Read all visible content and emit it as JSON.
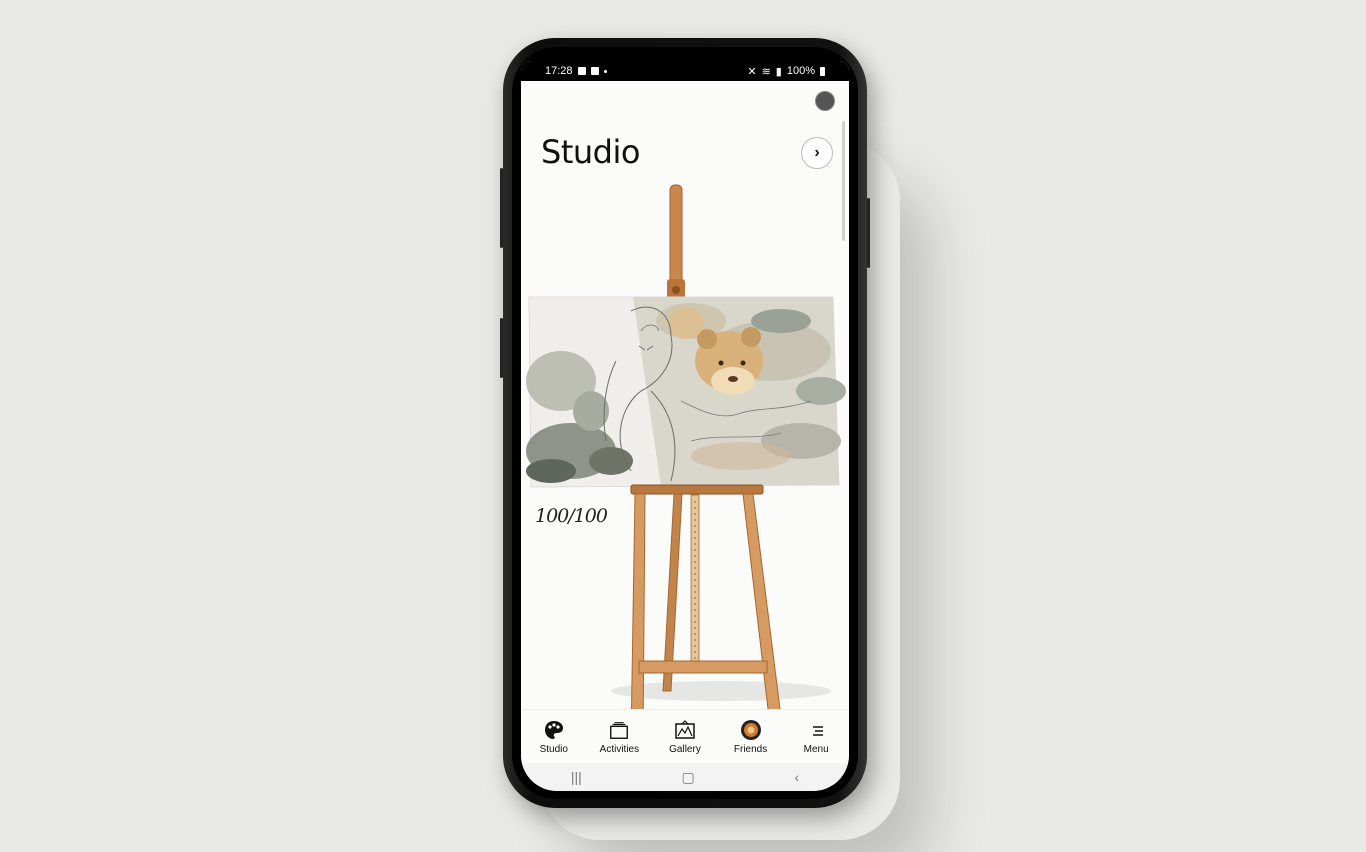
{
  "statusbar": {
    "time": "17:28",
    "battery": "100%"
  },
  "header": {
    "title": "Studio",
    "next_icon": "chevron-right-icon"
  },
  "canvas": {
    "progress": "100/100",
    "progress_fraction": 1.0
  },
  "bottom_nav": {
    "items": [
      {
        "label": "Studio",
        "icon": "palette-icon"
      },
      {
        "label": "Activities",
        "icon": "folder-stack-icon"
      },
      {
        "label": "Gallery",
        "icon": "gallery-frame-icon"
      },
      {
        "label": "Friends",
        "icon": "friends-avatar-icon"
      },
      {
        "label": "Menu",
        "icon": "menu-icon"
      }
    ]
  },
  "system_nav": {
    "recents": "|||",
    "home": "▢",
    "back": "‹"
  },
  "colors": {
    "wood": "#c98a4f",
    "wood_dark": "#a8662e",
    "accent": "#111111",
    "screen_bg": "#fbfbfa"
  }
}
